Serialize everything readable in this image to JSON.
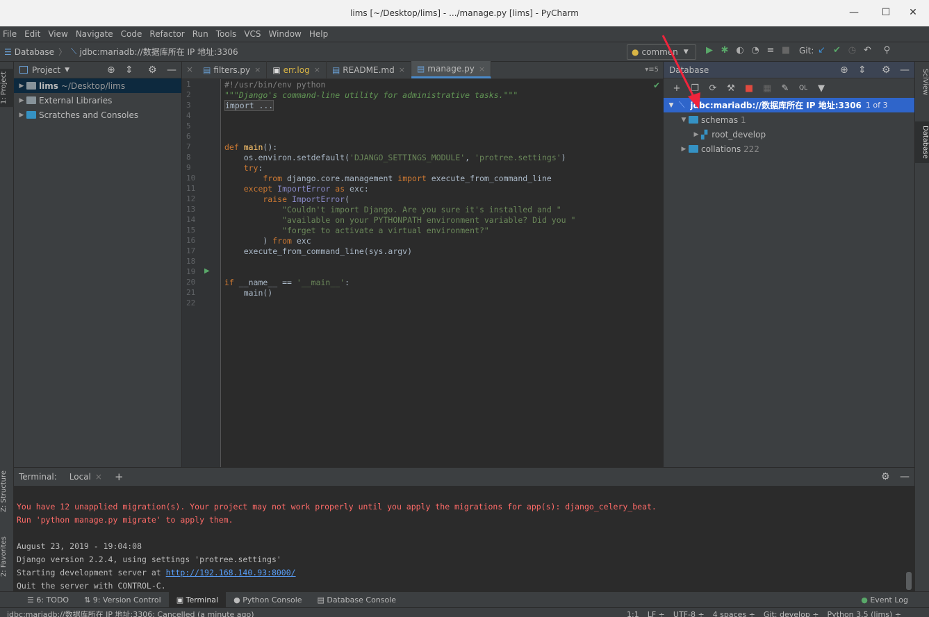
{
  "window": {
    "title": "lims [~/Desktop/lims] - .../manage.py [lims] - PyCharm"
  },
  "menu": [
    "File",
    "Edit",
    "View",
    "Navigate",
    "Code",
    "Refactor",
    "Run",
    "Tools",
    "VCS",
    "Window",
    "Help"
  ],
  "nav": {
    "root": "Database",
    "item": "jdbc:mariadb://数据库所在   IP 地址:3306",
    "run_config": "commen",
    "git_label": "Git:"
  },
  "project": {
    "title": "Project",
    "items": [
      {
        "label": "lims",
        "sub": "~/Desktop/lims"
      },
      {
        "label": "External Libraries",
        "sub": ""
      },
      {
        "label": "Scratches and Consoles",
        "sub": ""
      }
    ]
  },
  "tabs": [
    {
      "label": "filters.py",
      "active": false
    },
    {
      "label": "err.log",
      "active": false
    },
    {
      "label": "README.md",
      "active": false
    },
    {
      "label": "manage.py",
      "active": true
    }
  ],
  "code": [
    [
      [
        "cm",
        "#!/usr/bin/env python"
      ]
    ],
    [
      [
        "doc",
        "\"\"\"Django's command-line utility for administrative tasks.\"\"\""
      ]
    ],
    [
      [
        "fd",
        "import ..."
      ]
    ],
    [],
    [],
    [],
    [
      [
        "kw",
        "def "
      ],
      [
        "fn",
        "main"
      ],
      [
        "",
        "():"
      ]
    ],
    [
      [
        "",
        "    os.environ.setdefault("
      ],
      [
        "str",
        "'DJANGO_SETTINGS_MODULE'"
      ],
      [
        "",
        ", "
      ],
      [
        "str",
        "'protree.settings'"
      ],
      [
        "",
        ")"
      ]
    ],
    [
      [
        "kw",
        "    try"
      ],
      [
        "",
        ":"
      ]
    ],
    [
      [
        "kw",
        "        from "
      ],
      [
        "",
        "django.core.management "
      ],
      [
        "kw",
        "import "
      ],
      [
        "",
        "execute_from_command_line"
      ]
    ],
    [
      [
        "kw",
        "    except "
      ],
      [
        "bi",
        "ImportError "
      ],
      [
        "kw",
        "as "
      ],
      [
        "",
        "exc:"
      ]
    ],
    [
      [
        "kw",
        "        raise "
      ],
      [
        "bi",
        "ImportError"
      ],
      [
        "",
        "("
      ]
    ],
    [
      [
        "str",
        "            \"Couldn't import Django. Are you sure it's installed and \""
      ]
    ],
    [
      [
        "str",
        "            \"available on your PYTHONPATH environment variable? Did you \""
      ]
    ],
    [
      [
        "str",
        "            \"forget to activate a virtual environment?\""
      ]
    ],
    [
      [
        "",
        "        ) "
      ],
      [
        "kw",
        "from "
      ],
      [
        "",
        "exc"
      ]
    ],
    [
      [
        "",
        "    execute_from_command_line(sys.argv)"
      ]
    ],
    [],
    [],
    [
      [
        "kw",
        "if "
      ],
      [
        "",
        "__name__ == "
      ],
      [
        "str",
        "'__main__'"
      ],
      [
        "",
        ":"
      ]
    ],
    [
      [
        "",
        "    main()"
      ]
    ],
    []
  ],
  "database": {
    "title": "Database",
    "connection": "jdbc:mariadb://数据库所在   IP 地址:3306",
    "connection_count": "1 of 3",
    "schemas_label": "schemas",
    "schemas_count": "1",
    "schema": "root_develop",
    "collations_label": "collations",
    "collations_count": "222"
  },
  "terminal": {
    "title": "Terminal:",
    "tab": "Local",
    "lines": [
      {
        "t": "",
        "c": ""
      },
      {
        "t": "You have 12 unapplied migration(s). Your project may not work properly until you apply the migrations for app(s): django_celery_beat.",
        "c": "err"
      },
      {
        "t": "Run 'python manage.py migrate' to apply them.",
        "c": "err"
      },
      {
        "t": "",
        "c": ""
      },
      {
        "t": "August 23, 2019 - 19:04:08",
        "c": ""
      },
      {
        "t": "Django version 2.2.4, using settings 'protree.settings'",
        "c": ""
      },
      {
        "t": "Starting development server at ",
        "c": "",
        "link": "http://192.168.140.93:8000/"
      },
      {
        "t": "Quit the server with CONTROL-C.",
        "c": ""
      }
    ]
  },
  "bottom_tabs": [
    "6: TODO",
    "9: Version Control",
    "Terminal",
    "Python Console",
    "Database Console"
  ],
  "event_log": "Event Log",
  "side_tabs": {
    "project": "1: Project",
    "structure": "Z: Structure",
    "favorites": "2: Favorites",
    "sciview": "SciView",
    "database": "Database"
  },
  "status": {
    "message": "jdbc:mariadb://数据库所在   IP 地址:3306: Cancelled (a minute ago)",
    "position": "1:1",
    "line_sep": "LF ÷",
    "encoding": "UTF-8 ÷",
    "indent": "4 spaces ÷",
    "git": "Git: develop ÷",
    "interpreter": "Python 3.5 (lims) ÷"
  }
}
